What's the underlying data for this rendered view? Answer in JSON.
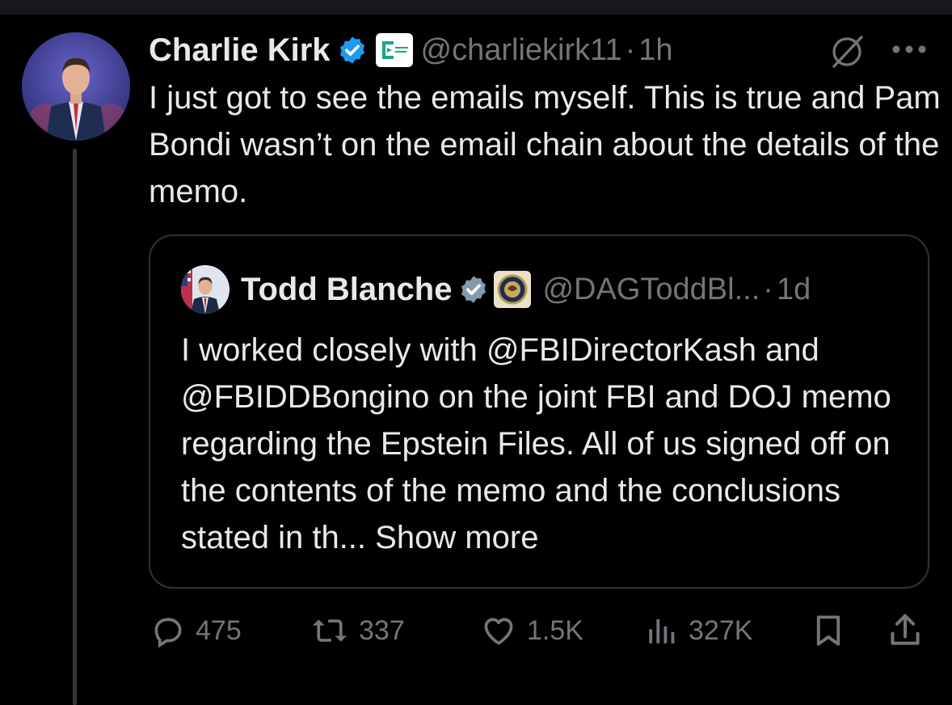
{
  "tweet": {
    "author": {
      "name": "Charlie Kirk",
      "handle": "@charliekirk11",
      "verified": true,
      "affiliation_badge": "turning-point-badge",
      "avatar": "avatar"
    },
    "separator": "·",
    "time": "1h",
    "text": "I just got to see the emails myself. This is true and Pam Bondi wasn’t on the email chain about the details of the memo.",
    "header_icons": [
      "grok-icon",
      "more-icon"
    ],
    "quoted": {
      "author": {
        "name": "Todd Blanche",
        "handle": "@DAGToddBl...",
        "verified": true,
        "affiliation_badge": "doj-seal-badge",
        "avatar": "avatar"
      },
      "separator": "·",
      "time": "1d",
      "text": "I worked closely with @FBIDirectorKash and @FBIDDBongino on the joint FBI and DOJ memo regarding the Epstein Files. All of us signed off on the contents of the memo and the conclusions stated in th...",
      "show_more": "Show more"
    },
    "actions": {
      "replies": "475",
      "reposts": "337",
      "likes": "1.5K",
      "views": "327K"
    },
    "action_icons": [
      "reply-icon",
      "repost-icon",
      "like-icon",
      "views-icon",
      "bookmark-icon",
      "share-icon"
    ]
  },
  "colors": {
    "background": "#000000",
    "text_primary": "#e7e9ea",
    "text_secondary": "#71767b",
    "border": "#2f3336",
    "verified_blue": "#1d9bf0",
    "verified_gray": "#829aab"
  }
}
